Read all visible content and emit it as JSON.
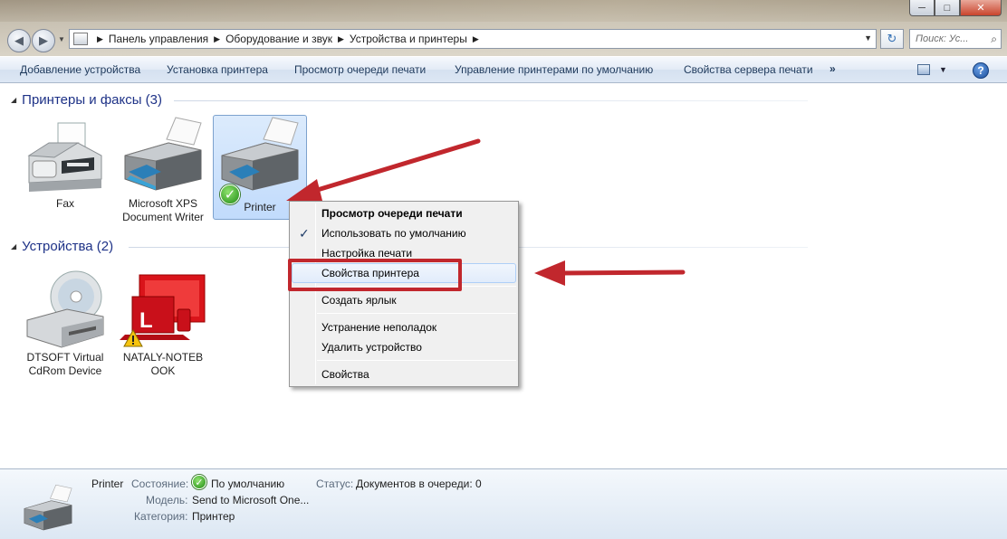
{
  "window": {
    "caption_buttons": [
      "─",
      "□",
      "✕"
    ]
  },
  "address": {
    "crumbs": [
      "Панель управления",
      "Оборудование и звук",
      "Устройства и принтеры"
    ],
    "search_placeholder": "Поиск: Ус..."
  },
  "toolbar": {
    "add_device": "Добавление устройства",
    "install_printer": "Установка принтера",
    "view_queue": "Просмотр очереди печати",
    "manage_default": "Управление принтерами по умолчанию",
    "server_props": "Свойства сервера печати",
    "more": "»",
    "help": "?"
  },
  "groups": {
    "printers": {
      "title": "Принтеры и факсы (3)",
      "items": [
        {
          "label": "Fax"
        },
        {
          "label1": "Microsoft XPS",
          "label2": "Document Writer"
        },
        {
          "label": "Printer"
        }
      ]
    },
    "devices": {
      "title": "Устройства (2)",
      "items": [
        {
          "label1": "DTSOFT Virtual",
          "label2": "CdRom Device"
        },
        {
          "label1": "NATALY-NOTEB",
          "label2": "OOK"
        }
      ]
    }
  },
  "context_menu": {
    "view_queue": "Просмотр очереди печати",
    "set_default": "Использовать по умолчанию",
    "print_setup": "Настройка печати",
    "printer_props": "Свойства принтера",
    "create_shortcut": "Создать ярлык",
    "troubleshoot": "Устранение неполадок",
    "remove_device": "Удалить устройство",
    "properties": "Свойства"
  },
  "details": {
    "name": "Printer",
    "state_label": "Состояние:",
    "state_value": "По умолчанию",
    "status_label": "Статус:",
    "status_value": "Документов в очереди: 0",
    "model_label": "Модель:",
    "model_value": "Send to Microsoft One...",
    "category_label": "Категория:",
    "category_value": "Принтер"
  },
  "colors": {
    "accent_link": "#1e395b",
    "group_title": "#1e3287",
    "annotation_red": "#c1272d",
    "selection_blue": "#c1dbfc"
  }
}
